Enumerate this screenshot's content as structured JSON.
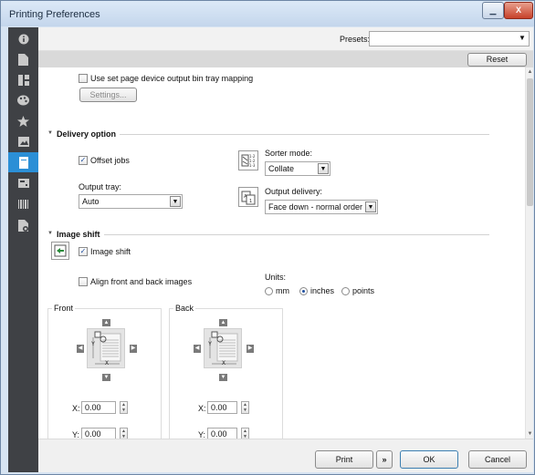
{
  "window": {
    "title": "Printing Preferences",
    "controls": {
      "minimize": "▁",
      "maximize": "▢",
      "close": "X"
    }
  },
  "sidebar": {
    "items": [
      {
        "icon": "info-icon",
        "active": false
      },
      {
        "icon": "document-icon",
        "active": false
      },
      {
        "icon": "layout-icon",
        "active": false
      },
      {
        "icon": "palette-icon",
        "active": false
      },
      {
        "icon": "star-icon",
        "active": false
      },
      {
        "icon": "image-icon",
        "active": false
      },
      {
        "icon": "output-icon",
        "active": true
      },
      {
        "icon": "device-icon",
        "active": false
      },
      {
        "icon": "barcode-icon",
        "active": false
      },
      {
        "icon": "page-settings-icon",
        "active": false
      }
    ]
  },
  "presets": {
    "label": "Presets:",
    "value": ""
  },
  "reset_label": "Reset",
  "bin_tray": {
    "checkbox_label": "Use set page device output bin tray mapping",
    "checked": false,
    "settings_label": "Settings..."
  },
  "delivery": {
    "title": "Delivery option",
    "offset_jobs_label": "Offset jobs",
    "offset_jobs_checked": true,
    "sorter_mode_label": "Sorter mode:",
    "sorter_mode_value": "Collate",
    "output_tray_label": "Output tray:",
    "output_tray_value": "Auto",
    "output_delivery_label": "Output delivery:",
    "output_delivery_value": "Face down - normal order"
  },
  "image_shift": {
    "title": "Image shift",
    "image_shift_label": "Image shift",
    "image_shift_checked": true,
    "align_label": "Align front and back images",
    "align_checked": false,
    "units_label": "Units:",
    "units": [
      {
        "label": "mm",
        "selected": false
      },
      {
        "label": "inches",
        "selected": true
      },
      {
        "label": "points",
        "selected": false
      }
    ],
    "front": {
      "label": "Front",
      "x_label": "X:",
      "x_value": "0.00",
      "y_label": "Y:",
      "y_value": "0.00"
    },
    "back": {
      "label": "Back",
      "x_label": "X:",
      "x_value": "0.00",
      "y_label": "Y:",
      "y_value": "0.00"
    },
    "diagram_y": "Y",
    "diagram_x": "X"
  },
  "footer": {
    "print_label": "Print",
    "menu_label": "»",
    "ok_label": "OK",
    "cancel_label": "Cancel"
  },
  "colors": {
    "sidebar_bg": "#3f4145",
    "sidebar_active": "#2b8fd6",
    "title_bar": "#c4d6ec",
    "close_button": "#c7412a"
  }
}
